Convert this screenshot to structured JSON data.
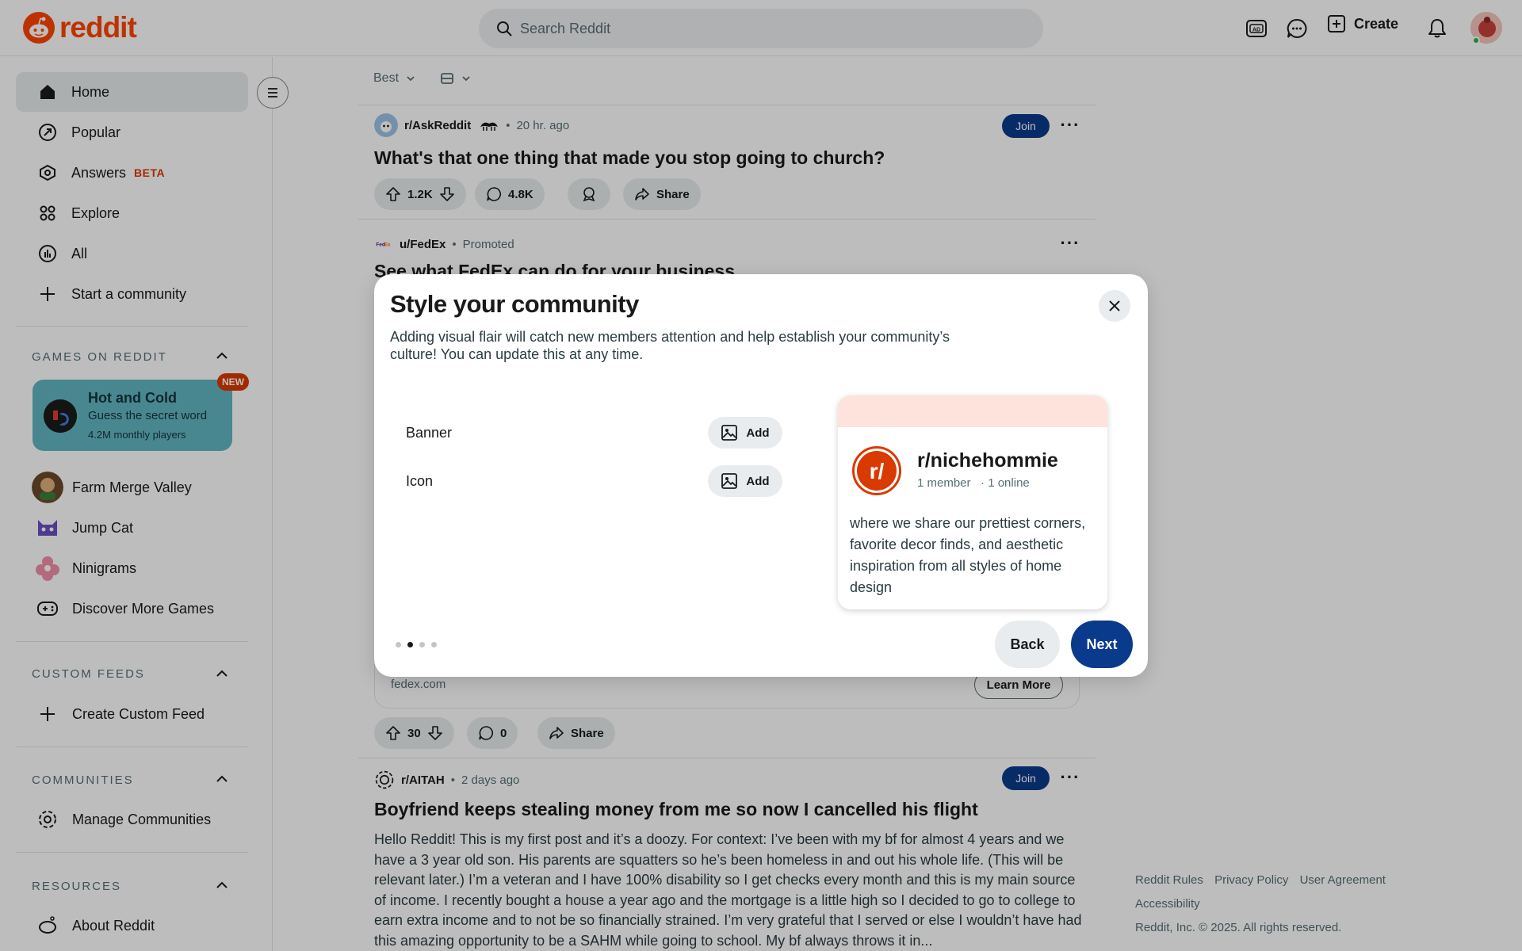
{
  "header": {
    "logo_text": "reddit",
    "search_placeholder": "Search Reddit",
    "create_label": "Create",
    "brand_color": "#ff4500"
  },
  "sidebar": {
    "nav": [
      {
        "label": "Home",
        "icon": "home-icon",
        "active": true
      },
      {
        "label": "Popular",
        "icon": "popular-icon"
      },
      {
        "label": "Answers",
        "icon": "answers-icon",
        "badge": "BETA"
      },
      {
        "label": "Explore",
        "icon": "explore-icon"
      },
      {
        "label": "All",
        "icon": "all-icon"
      },
      {
        "label": "Start a community",
        "icon": "plus-icon"
      }
    ],
    "games_title": "GAMES ON REDDIT",
    "featured_game": {
      "title": "Hot and Cold",
      "subtitle": "Guess the secret word",
      "players": "4.2M monthly players",
      "badge": "NEW"
    },
    "games": [
      "Farm Merge Valley",
      "Jump Cat",
      "Ninigrams"
    ],
    "discover_games": "Discover More Games",
    "custom_feeds_title": "CUSTOM FEEDS",
    "create_custom_feed": "Create Custom Feed",
    "communities_title": "COMMUNITIES",
    "manage_communities": "Manage Communities",
    "resources_title": "RESOURCES",
    "about_reddit": "About Reddit"
  },
  "feed": {
    "sort_label": "Best",
    "posts": [
      {
        "subreddit": "r/AskReddit",
        "time": "20 hr. ago",
        "join": "Join",
        "title": "What's that one thing that made you stop going to church?",
        "upvotes": "1.2K",
        "comments": "4.8K",
        "share": "Share"
      },
      {
        "subreddit": "u/FedEx",
        "time": "Promoted",
        "title": "See what FedEx can do for your business",
        "domain": "fedex.com",
        "cta": "Learn More",
        "upvotes": "30",
        "comments": "0",
        "share": "Share"
      },
      {
        "subreddit": "r/AITAH",
        "time": "2 days ago",
        "join": "Join",
        "title": "Boyfriend keeps stealing money from me so now I cancelled his flight",
        "body": "Hello Reddit! This is my first post and it’s a doozy. For context: I’ve been with my bf for almost 4 years and we have a 3 year old son. His parents are squatters so he’s been homeless in and out his whole life. (This will be relevant later.) I’m a veteran and I have 100% disability so I get checks every month and this is my main source of income. I recently bought a house a year ago and the mortgage is a little high so I decided to go to college to earn extra income and to not be so financially strained. I’m very grateful that I served or else I wouldn’t have had this amazing opportunity to be a SAHM while going to school. My bf always throws it in..."
      }
    ]
  },
  "footer": {
    "links": [
      "Reddit Rules",
      "Privacy Policy",
      "User Agreement",
      "Accessibility"
    ],
    "copyright": "Reddit, Inc. © 2025. All rights reserved."
  },
  "modal": {
    "title": "Style your community",
    "description": "Adding visual flair will catch new members attention and help establish your community’s culture! You can update this at any time.",
    "banner_label": "Banner",
    "icon_label": "Icon",
    "add_label": "Add",
    "preview": {
      "name": "r/nichehommie",
      "members": "1 member",
      "online": "· 1 online",
      "description": "where we share our prettiest corners, favorite decor finds, and aesthetic inspiration from all styles of home design",
      "banner_color": "#fde3dc"
    },
    "steps_total": 4,
    "step_current": 2,
    "back_label": "Back",
    "next_label": "Next",
    "primary_color": "#0a3a8c"
  }
}
